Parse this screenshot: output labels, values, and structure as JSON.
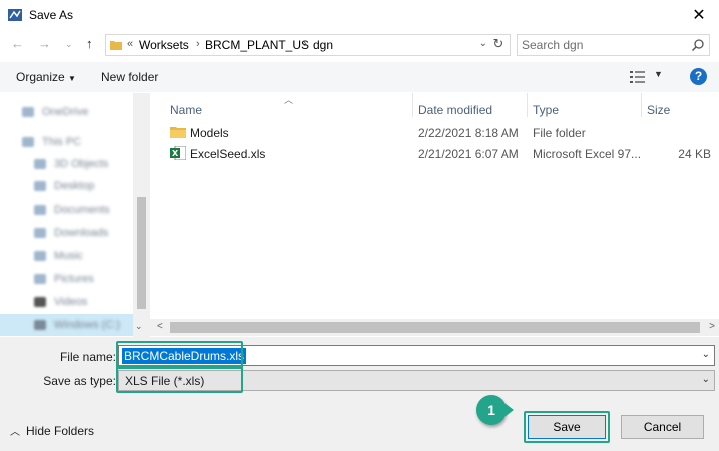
{
  "window": {
    "title": "Save As"
  },
  "address": {
    "overflow": "«",
    "crumbs": [
      "Worksets",
      "BRCM_PLANT_US",
      "dgn"
    ],
    "search_placeholder": "Search dgn"
  },
  "toolbar": {
    "organize": "Organize",
    "new_folder": "New folder",
    "help": "?"
  },
  "sidebar": {
    "items": [
      {
        "label": "OneDrive"
      },
      {
        "label": "This PC"
      },
      {
        "label": "3D Objects"
      },
      {
        "label": "Desktop"
      },
      {
        "label": "Documents"
      },
      {
        "label": "Downloads"
      },
      {
        "label": "Music"
      },
      {
        "label": "Pictures"
      },
      {
        "label": "Videos"
      },
      {
        "label": "Windows (C:)"
      }
    ]
  },
  "filelist": {
    "columns": {
      "name": "Name",
      "date": "Date modified",
      "type": "Type",
      "size": "Size"
    },
    "rows": [
      {
        "name": "Models",
        "date": "2/22/2021 8:18 AM",
        "type": "File folder",
        "size": "",
        "icon": "folder-icon"
      },
      {
        "name": "ExcelSeed.xls",
        "date": "2/21/2021 6:07 AM",
        "type": "Microsoft Excel 97...",
        "size": "24 KB",
        "icon": "excel-file-icon"
      }
    ]
  },
  "form": {
    "filename_label": "File name:",
    "filename_value": "BRCMCableDrums.xls",
    "savetype_label": "Save as type:",
    "savetype_value": "XLS File (*.xls)"
  },
  "footer": {
    "hide_folders": "Hide Folders",
    "save": "Save",
    "cancel": "Cancel"
  },
  "annotation": {
    "step": "1",
    "color": "#22a58b"
  }
}
